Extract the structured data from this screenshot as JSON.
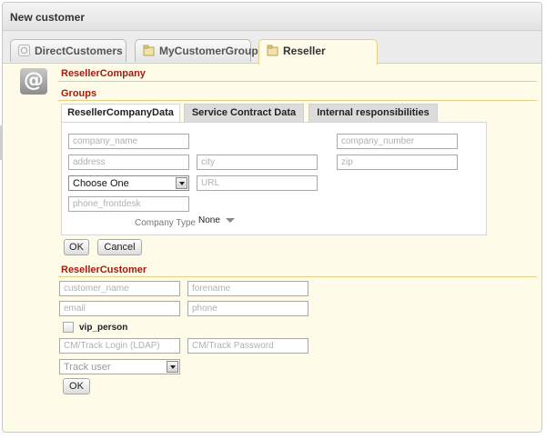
{
  "window": {
    "title": "New customer"
  },
  "tabs": [
    {
      "label": "DirectCustomers",
      "icon": "customers-icon"
    },
    {
      "label": "MyCustomerGroup",
      "icon": "folder-icon"
    },
    {
      "label": "Reseller",
      "icon": "folder-icon"
    }
  ],
  "reseller_company": {
    "title": "ResellerCompany",
    "groups_title": "Groups",
    "subtabs": [
      "ResellerCompanyData",
      "Service Contract Data",
      "Internal responsibilities"
    ],
    "fields": {
      "company_name": "company_name",
      "company_number": "company_number",
      "address": "address",
      "city": "city",
      "zip": "zip",
      "url": "URL",
      "phone_frontdesk": "phone_frontdesk"
    },
    "choose_select": "Choose One",
    "company_type_label": "Company Type",
    "company_type_value": "None",
    "ok": "OK",
    "cancel": "Cancel"
  },
  "reseller_customer": {
    "title": "ResellerCustomer",
    "fields": {
      "customer_name": "customer_name",
      "forename": "forename",
      "email": "email",
      "phone": "phone",
      "login": "CM/Track Login (LDAP)",
      "password": "CM/Track Password"
    },
    "vip_label": "vip_person",
    "track_select": "Track user",
    "ok": "OK"
  },
  "colors": {
    "accent": "#a11d0e",
    "panel_bg": "#fffbe9",
    "border": "#e6cf84"
  }
}
